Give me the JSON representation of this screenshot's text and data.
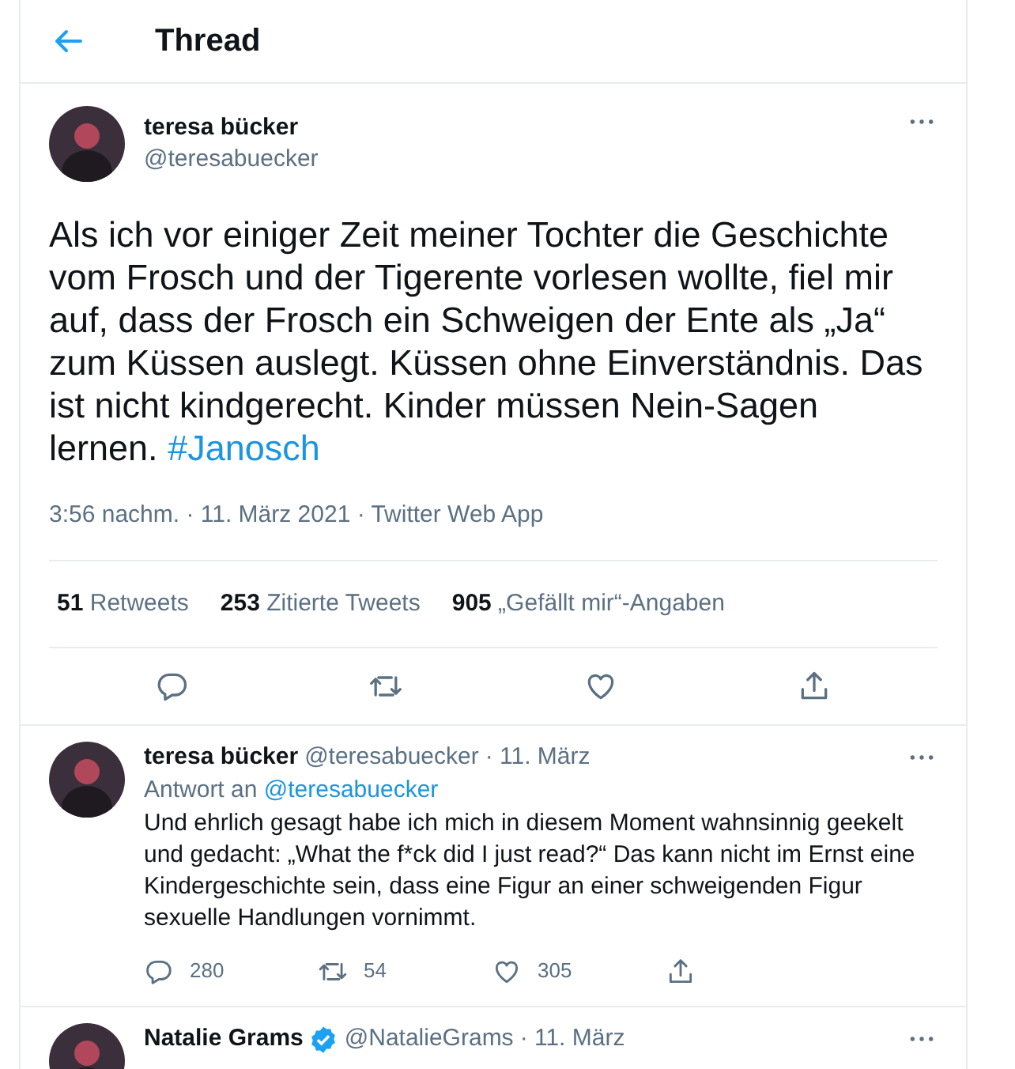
{
  "header": {
    "title": "Thread"
  },
  "main_tweet": {
    "name": "teresa bücker",
    "handle": "@teresabuecker",
    "text": "Als ich vor einiger Zeit meiner Tochter die Geschichte vom Frosch und der Tigerente vorlesen wollte, fiel mir auf, dass der Frosch ein Schweigen der Ente als „Ja“ zum Küssen auslegt. Küssen ohne Einverständnis. Das ist nicht kindgerecht. Kinder müssen Nein-Sagen lernen.",
    "hashtag": "#Janosch",
    "timestamp": "3:56 nachm. · 11. März 2021 · Twitter Web App",
    "stats": [
      {
        "count": "51",
        "label": "Retweets"
      },
      {
        "count": "253",
        "label": "Zitierte Tweets"
      },
      {
        "count": "905",
        "label": "„Gefällt mir“-Angaben"
      }
    ],
    "actions": [
      {
        "kind": "reply"
      },
      {
        "kind": "retweet"
      },
      {
        "kind": "like"
      },
      {
        "kind": "share"
      }
    ]
  },
  "replies": [
    {
      "name": "teresa bücker",
      "verified": false,
      "handle": "@teresabuecker",
      "date": "· 11. März",
      "replying_label": "Antwort an",
      "replying_to": "@teresabuecker",
      "text": "Und ehrlich gesagt habe ich mich in diesem Moment wahnsinnig geekelt und gedacht: „What the f*ck did I just read?“ Das kann nicht im Ernst eine Kindergeschichte sein, dass eine Figur an einer schweigenden Figur sexuelle Handlungen vornimmt.",
      "actions": [
        {
          "kind": "reply",
          "count": "280"
        },
        {
          "kind": "retweet",
          "count": "54"
        },
        {
          "kind": "like",
          "count": "305"
        },
        {
          "kind": "share"
        }
      ]
    },
    {
      "name": "Natalie Grams",
      "verified": true,
      "handle": "@NatalieGrams",
      "date": "· 11. März"
    }
  ]
}
